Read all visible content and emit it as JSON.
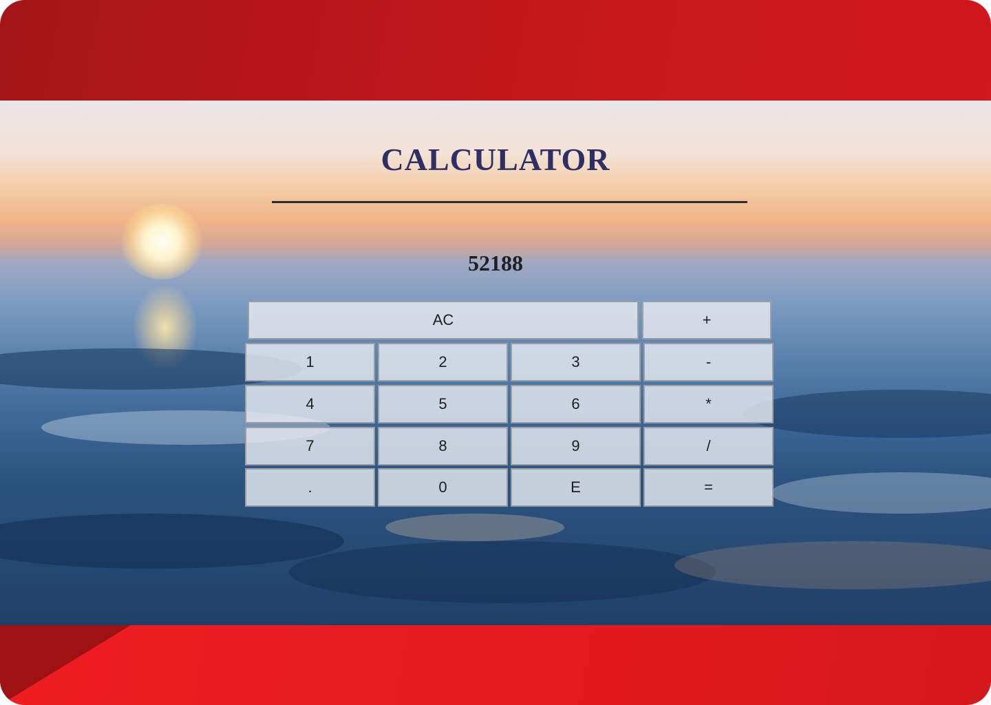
{
  "app": {
    "title": "CALCULATOR"
  },
  "display": {
    "value": "52188"
  },
  "buttons": {
    "clear": "AC",
    "plus": "+",
    "one": "1",
    "two": "2",
    "three": "3",
    "minus": "-",
    "four": "4",
    "five": "5",
    "six": "6",
    "multiply": "*",
    "seven": "7",
    "eight": "8",
    "nine": "9",
    "divide": "/",
    "dot": ".",
    "zero": "0",
    "exp": "E",
    "equals": "="
  },
  "colors": {
    "frame_red": "#c8181b",
    "title_navy": "#2e2f64",
    "button_face": "#e8eaf0"
  }
}
